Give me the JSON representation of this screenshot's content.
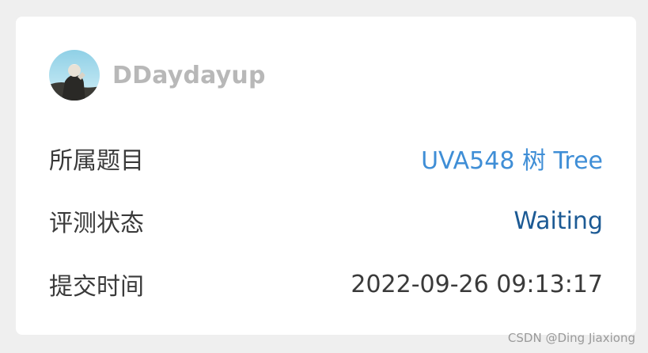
{
  "submission": {
    "username": "DDaydayup",
    "avatar_icon": "user-avatar",
    "rows": {
      "problem_label": "所属题目",
      "problem_value": "UVA548 树 Tree",
      "status_label": "评测状态",
      "status_value": "Waiting",
      "time_label": "提交时间",
      "time_value": "2022-09-26 09:13:17"
    }
  },
  "watermark": "CSDN @Ding Jiaxiong",
  "colors": {
    "background": "#efefef",
    "card": "#ffffff",
    "username": "#b8b8b8",
    "link": "#3f8ed6",
    "status_waiting": "#1c5a94",
    "text": "#3a3a3a"
  }
}
